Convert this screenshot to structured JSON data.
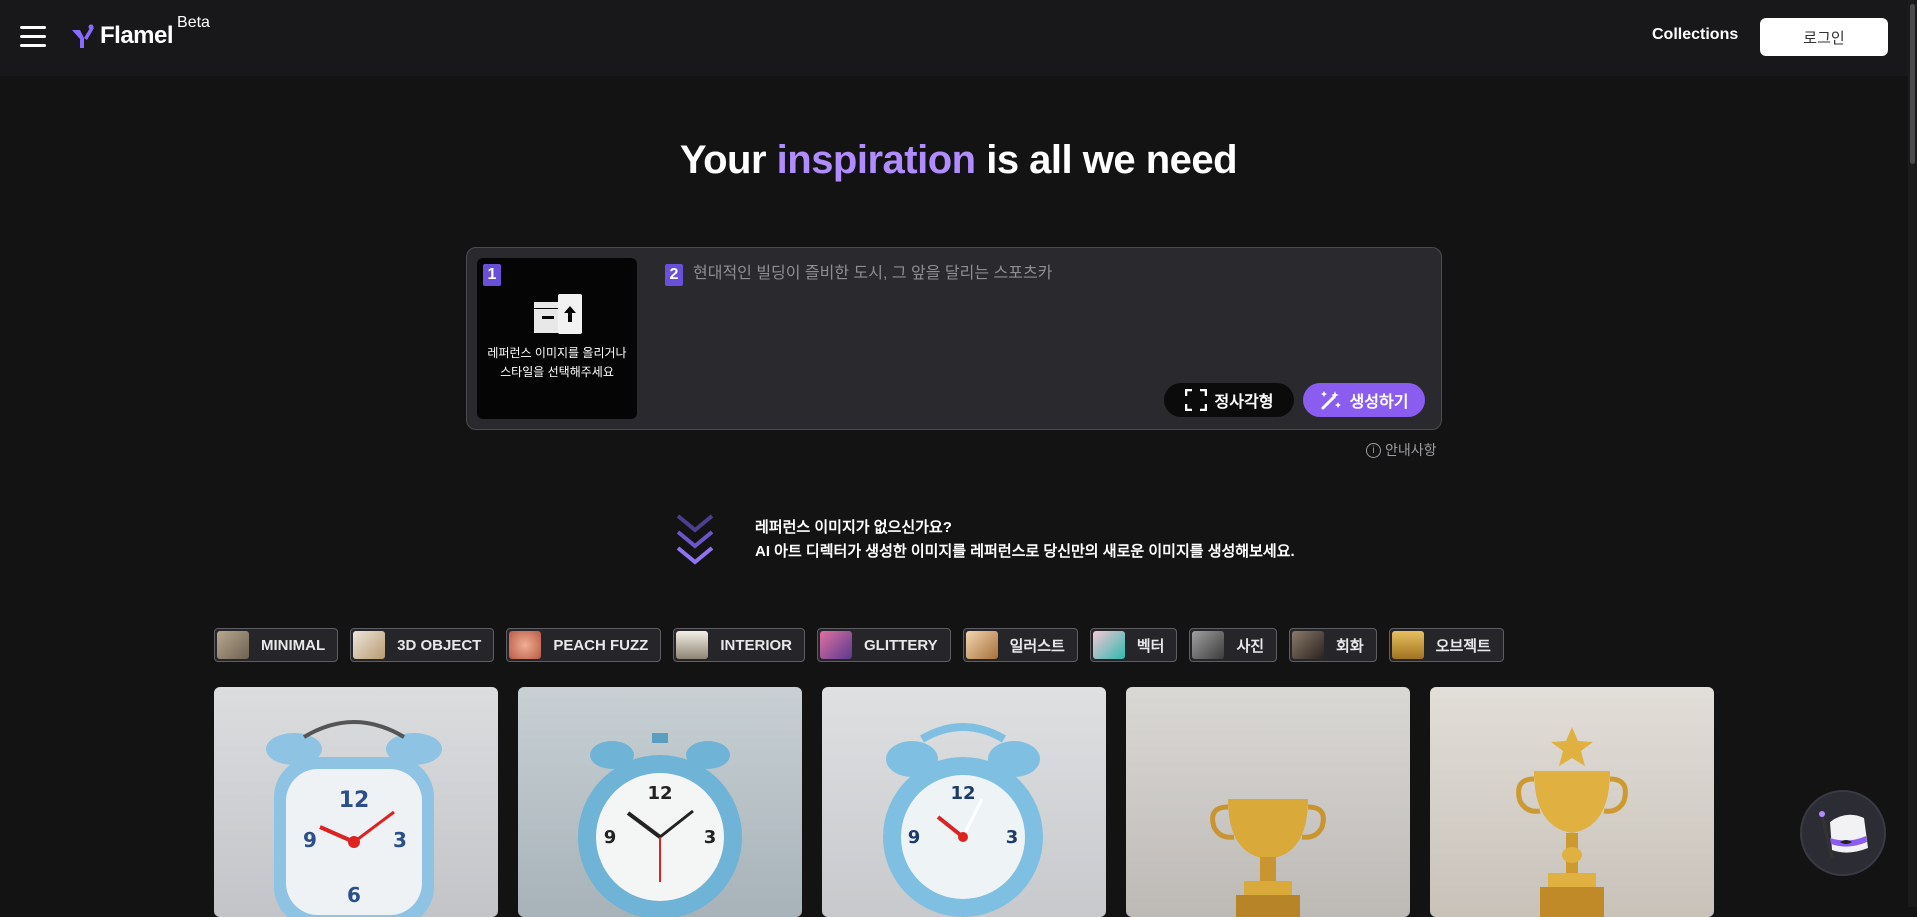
{
  "header": {
    "logo_text": "Flamel",
    "beta_label": "Beta",
    "collections_label": "Collections",
    "login_label": "로그인"
  },
  "hero": {
    "headline_before": "Your ",
    "headline_accent": "inspiration",
    "headline_after": " is all we need"
  },
  "prompt": {
    "step1_number": "1",
    "reference_text_line1": "레퍼런스 이미지를 올리거나",
    "reference_text_line2": "스타일을 선택해주세요",
    "step2_number": "2",
    "placeholder": "현대적인 빌딩이 즐비한 도시, 그 앞을 달리는 스포츠카",
    "ratio_label": "정사각형",
    "generate_label": "생성하기",
    "guide_label": "안내사항"
  },
  "promo": {
    "line1": "레퍼런스 이미지가 없으신가요?",
    "line2": "AI 아트 디렉터가 생성한 이미지를 레퍼런스로 당신만의 새로운 이미지를 생성해보세요."
  },
  "style_chips": [
    {
      "label": "MINIMAL",
      "color": "#8a7a66"
    },
    {
      "label": "3D OBJECT",
      "color": "#c9b9a0"
    },
    {
      "label": "PEACH FUZZ",
      "color": "#d98a6a"
    },
    {
      "label": "INTERIOR",
      "color": "#e8e2d8"
    },
    {
      "label": "GLITTERY",
      "color": "#c05a8a"
    },
    {
      "label": "일러스트",
      "color": "#d6a877"
    },
    {
      "label": "벡터",
      "color": "#e8a5b8"
    },
    {
      "label": "사진",
      "color": "#6f6f6f"
    },
    {
      "label": "회화",
      "color": "#5a4a40"
    },
    {
      "label": "오브젝트",
      "color": "#c9a045"
    }
  ],
  "gallery": [
    {
      "subject": "blue square alarm clock",
      "bg": "#d6d7d9"
    },
    {
      "subject": "blue round alarm clock",
      "bg": "#bdc7cc"
    },
    {
      "subject": "blue alarm clock",
      "bg": "#d8d9db"
    },
    {
      "subject": "gold trophy",
      "bg": "#d4d2cf"
    },
    {
      "subject": "gold star trophy",
      "bg": "#dbd7d1"
    }
  ],
  "colors": {
    "accent": "#b18cff",
    "button_purple": "#8a5cf0",
    "background": "#131314"
  }
}
